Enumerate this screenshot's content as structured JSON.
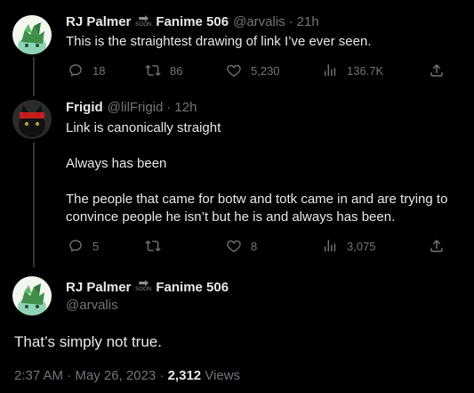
{
  "tweets": [
    {
      "name": "RJ Palmer",
      "badge_text": "SOON",
      "suffix": "Fanime 506",
      "handle": "@arvalis",
      "dot": "·",
      "time": "21h",
      "text": "This is the straightest drawing of link I’ve ever seen.",
      "actions": {
        "reply": "18",
        "retweet": "86",
        "like": "5,230",
        "views": "136.7K"
      }
    },
    {
      "name": "Frigid",
      "handle": "@lilFrigid",
      "dot": "·",
      "time": "12h",
      "paragraphs": [
        "Link is canonically straight",
        "Always has been",
        "The people that came for botw and totk came in and are trying to convince people he isn’t but he is and always has been."
      ],
      "actions": {
        "reply": "5",
        "retweet": "",
        "like": "8",
        "views": "3,075"
      }
    }
  ],
  "main": {
    "name": "RJ Palmer",
    "badge_text": "SOON",
    "suffix": "Fanime 506",
    "handle": "@arvalis",
    "text": "That’s simply not true.",
    "timestamp": "2:37 AM · May 26, 2023 · ",
    "views_count": "2,312",
    "views_label": " Views"
  },
  "colors": {
    "background": "#000000",
    "text": "#e7e9ea",
    "muted": "#71767b",
    "thread_line": "#333639"
  },
  "icons": [
    "reply-icon",
    "retweet-icon",
    "like-icon",
    "views-icon",
    "share-icon"
  ]
}
